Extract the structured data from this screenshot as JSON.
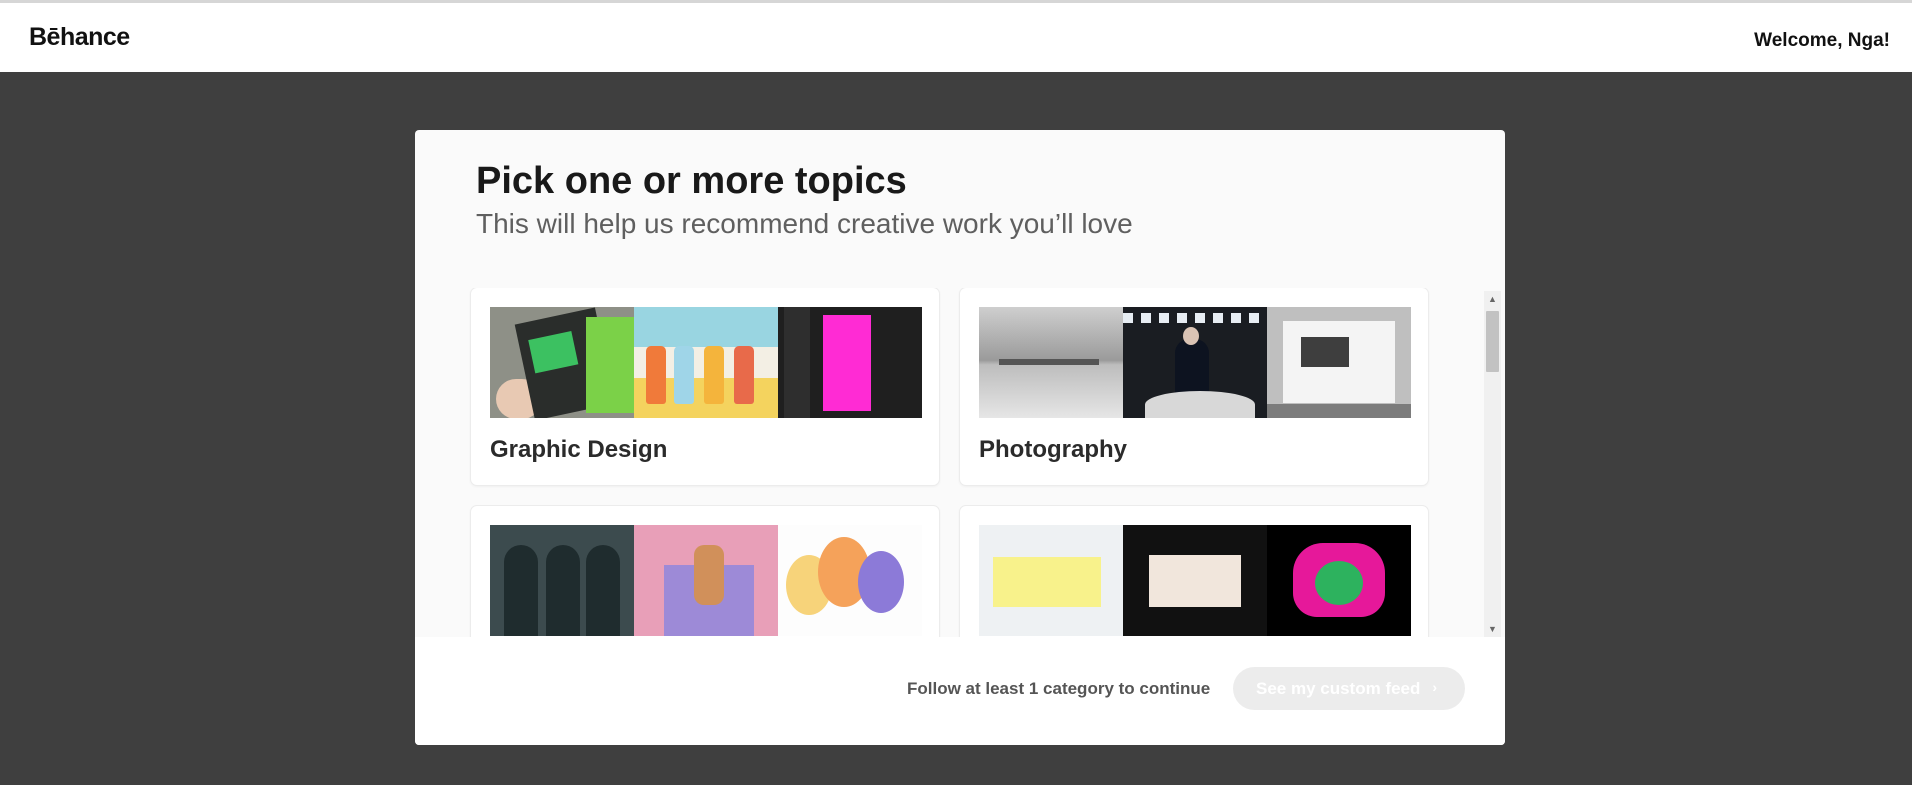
{
  "header": {
    "logo": "Bēhance",
    "welcome": "Welcome, Nga!"
  },
  "modal": {
    "title": "Pick one or more topics",
    "subtitle": "This will help us recommend creative work you’ll love",
    "topics": [
      {
        "label": "Graphic Design"
      },
      {
        "label": "Photography"
      },
      {
        "label": ""
      },
      {
        "label": ""
      }
    ],
    "footer": {
      "note": "Follow at least 1 category to continue",
      "cta_label": "See my custom feed"
    }
  },
  "colors": {
    "backdrop": "#3f3f3f",
    "cta_disabled": "#ececec"
  }
}
